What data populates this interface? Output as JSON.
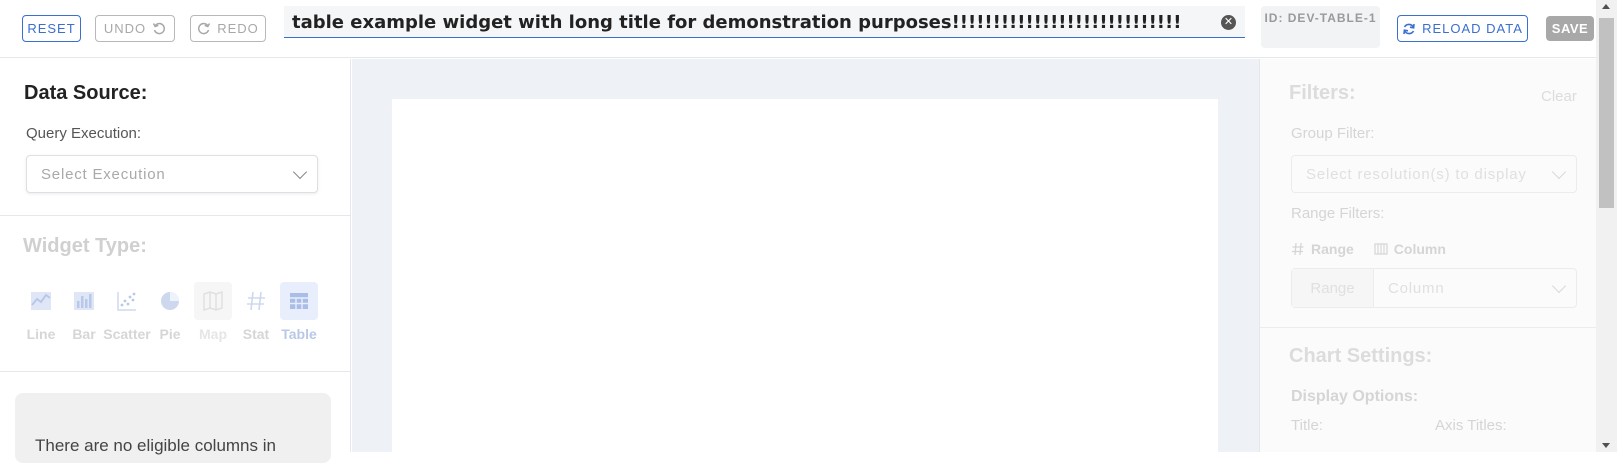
{
  "toolbar": {
    "reset_label": "RESET",
    "undo_label": "UNDO",
    "redo_label": "REDO",
    "title_value": "table example widget with long title for demonstration purposes!!!!!!!!!!!!!!!!!!!!!!!!!!!!",
    "id_label": "ID: DEV-TABLE-1",
    "reload_label": "RELOAD DATA",
    "save_label": "SAVE",
    "colors": {
      "accent": "#3a6fcf",
      "disabled": "#a8a8a8"
    }
  },
  "left_panel": {
    "data_source": {
      "heading": "Data Source:",
      "query_label": "Query Execution:",
      "select_placeholder": "Select Execution"
    },
    "widget_type": {
      "heading": "Widget Type:",
      "types": [
        {
          "label": "Line",
          "icon": "line-chart-icon",
          "active": false
        },
        {
          "label": "Bar",
          "icon": "bar-chart-icon",
          "active": false
        },
        {
          "label": "Scatter",
          "icon": "scatter-chart-icon",
          "active": false
        },
        {
          "label": "Pie",
          "icon": "pie-chart-icon",
          "active": false
        },
        {
          "label": "Map",
          "icon": "map-icon",
          "active": false
        },
        {
          "label": "Stat",
          "icon": "hash-icon",
          "active": false
        },
        {
          "label": "Table",
          "icon": "table-icon",
          "active": true
        }
      ]
    },
    "empty_message": "There are no eligible columns in"
  },
  "right_panel": {
    "filters": {
      "heading": "Filters:",
      "clear_label": "Clear",
      "group_filter_label": "Group Filter:",
      "group_filter_placeholder": "Select resolution(s) to display",
      "range_filters_label": "Range Filters:",
      "range_tab": "Range",
      "column_tab": "Column",
      "range_placeholder": "Range",
      "column_placeholder": "Column"
    },
    "chart_settings": {
      "heading": "Chart Settings:",
      "display_options_label": "Display Options:",
      "title_label": "Title:",
      "axis_titles_label": "Axis Titles:"
    }
  }
}
